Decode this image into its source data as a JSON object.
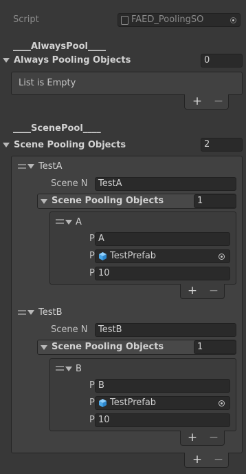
{
  "script_row": {
    "label": "Script",
    "value": "FAED_PoolingSO"
  },
  "always_pool": {
    "header": "____AlwaysPool____",
    "list_label": "Always Pooling Objects",
    "count": "0",
    "empty_text": "List is Empty"
  },
  "scene_pool": {
    "header": "____ScenePool____",
    "list_label": "Scene Pooling Objects",
    "count": "2",
    "elements": [
      {
        "name": "TestA",
        "scene_label": "Scene N",
        "scene_value": "TestA",
        "objects_label": "Scene Pooling Objects",
        "objects_count": "1",
        "object": {
          "name": "A",
          "p1_label": "P",
          "p1_value": "A",
          "p2_label": "P",
          "p2_value": "TestPrefab",
          "p3_label": "P",
          "p3_value": "10"
        }
      },
      {
        "name": "TestB",
        "scene_label": "Scene N",
        "scene_value": "TestB",
        "objects_label": "Scene Pooling Objects",
        "objects_count": "1",
        "object": {
          "name": "B",
          "p1_label": "P",
          "p1_value": "B",
          "p2_label": "P",
          "p2_value": "TestPrefab",
          "p3_label": "P",
          "p3_value": "10"
        }
      }
    ]
  },
  "buttons": {
    "plus": "+",
    "minus": "−"
  },
  "colors": {
    "background": "#383838",
    "field": "#2a2a2a",
    "prefab_icon": "#5ab4f0"
  },
  "icons": [
    "script-icon",
    "object-picker-icon",
    "prefab-cube-icon",
    "foldout-arrow-icon",
    "drag-handle-icon"
  ]
}
